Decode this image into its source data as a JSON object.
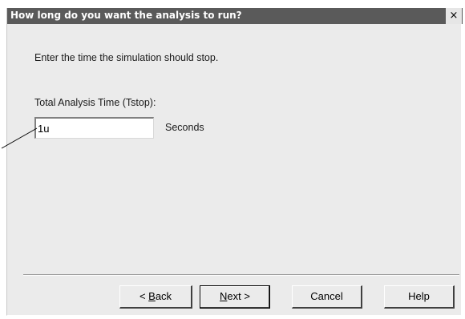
{
  "window": {
    "title": "How long do you want the analysis to run?",
    "close_glyph": "×"
  },
  "content": {
    "instruction": "Enter the time the simulation should stop.",
    "field_label": "Total Analysis Time (Tstop):",
    "field_value": "1u",
    "units": "Seconds"
  },
  "buttons": {
    "back_pre": "< ",
    "back_key": "B",
    "back_rest": "ack",
    "next_key": "N",
    "next_rest": "ext >",
    "cancel": "Cancel",
    "help": "Help"
  },
  "colors": {
    "titlebar": "#5a5a5a",
    "dialog_bg": "#ebebeb"
  }
}
